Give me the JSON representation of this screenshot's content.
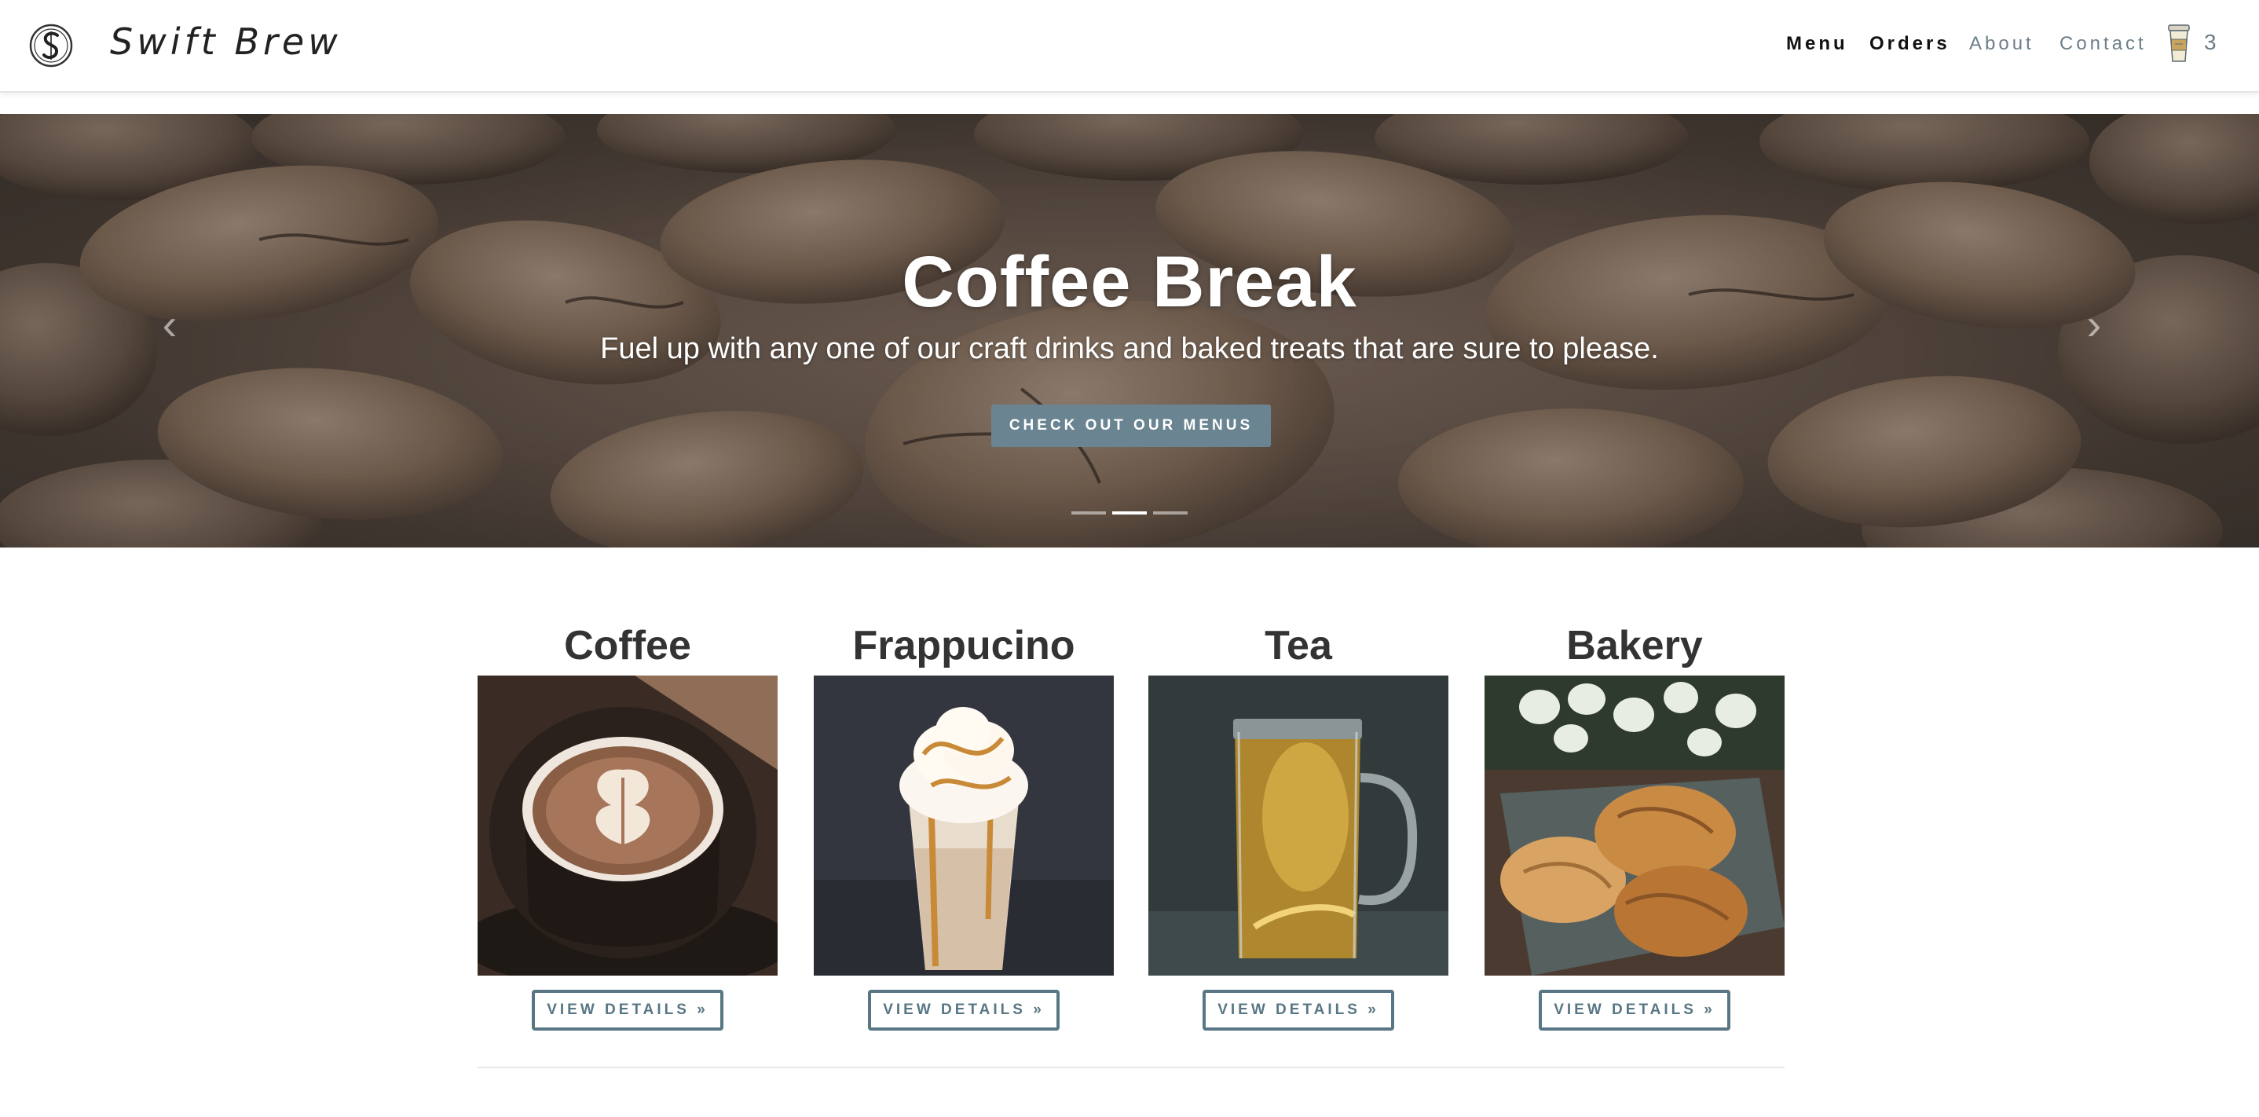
{
  "header": {
    "brand": "Swift Brew",
    "logo_icon": "swift-brew-s-logo-icon",
    "nav": [
      {
        "label": "Menu"
      },
      {
        "label": "Orders"
      },
      {
        "label": "About"
      },
      {
        "label": "Contact"
      }
    ],
    "cart_icon": "coffee-cup-cart-icon",
    "cart_count": "3"
  },
  "hero": {
    "title": "Coffee Break",
    "subtitle": "Fuel up with any one of our craft drinks and baked treats that are sure to please.",
    "button_label": "CHECK OUT OUR MENUS",
    "prev_icon": "chevron-left-icon",
    "next_icon": "chevron-right-icon",
    "slide_count": 3,
    "active_slide": 2
  },
  "categories": [
    {
      "title": "Coffee",
      "button_label": "VIEW DETAILS »"
    },
    {
      "title": "Frappucino",
      "button_label": "VIEW DETAILS »"
    },
    {
      "title": "Tea",
      "button_label": "VIEW DETAILS »"
    },
    {
      "title": "Bakery",
      "button_label": "VIEW DETAILS »"
    }
  ],
  "colors": {
    "accent": "#6a8591",
    "button_border": "#587683",
    "nav_muted": "#6d7e88",
    "nav_dark": "#111111"
  }
}
